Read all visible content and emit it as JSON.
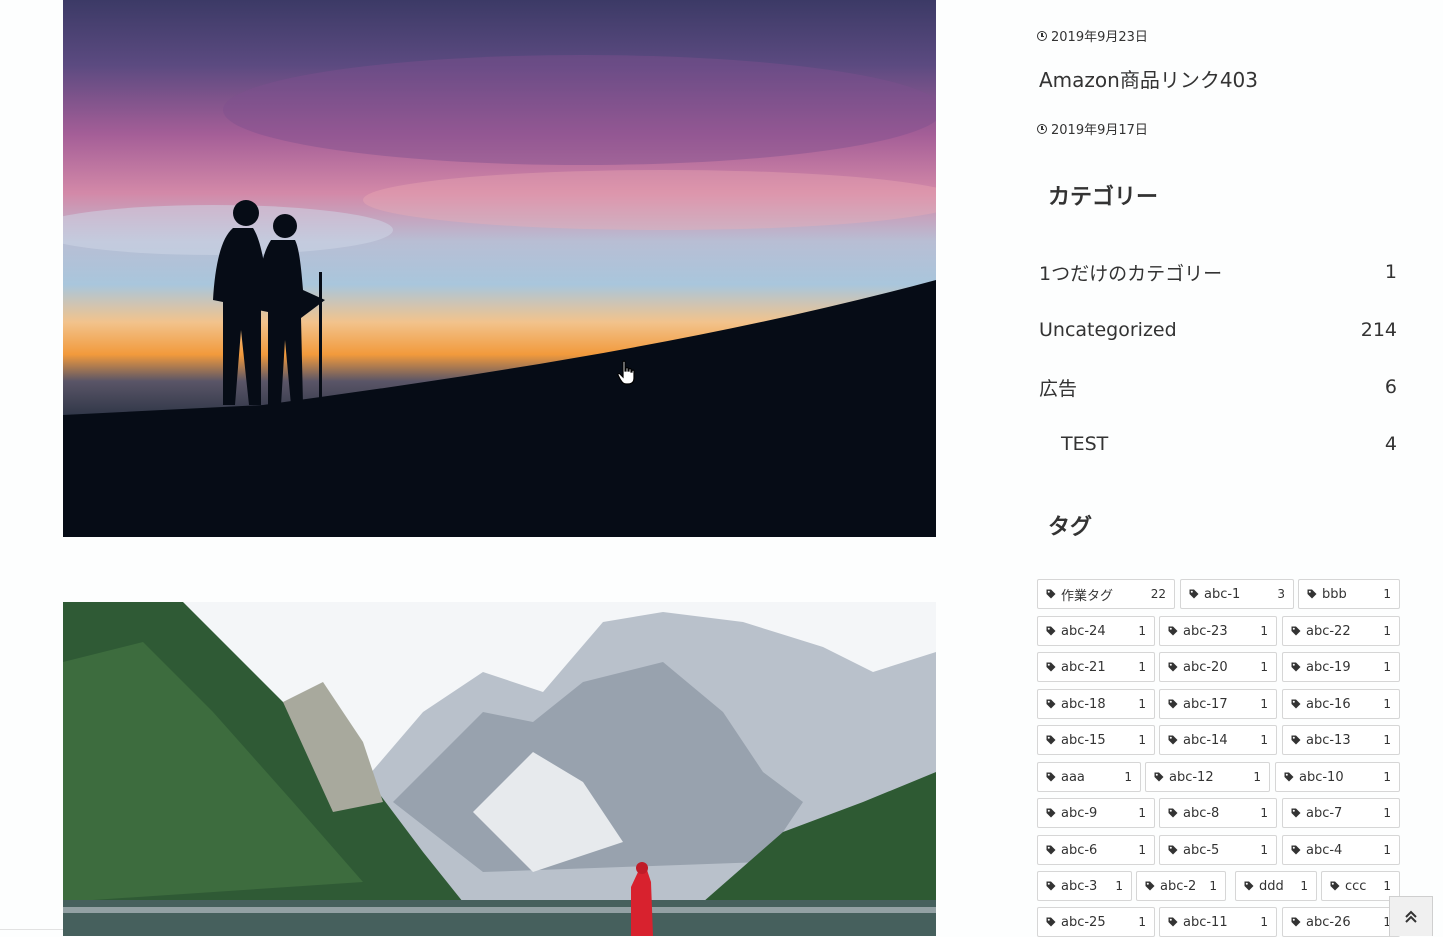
{
  "recent_posts": {
    "first_date": "2019年9月23日",
    "second_title": "Amazon商品リンク403",
    "second_date": "2019年9月17日"
  },
  "categories": {
    "title": "カテゴリー",
    "items": [
      {
        "label": "1つだけのカテゴリー",
        "count": "1"
      },
      {
        "label": "Uncategorized",
        "count": "214"
      },
      {
        "label": "広告",
        "count": "6"
      },
      {
        "label": "TEST",
        "count": "4"
      }
    ]
  },
  "tags": {
    "title": "タグ",
    "items": [
      {
        "label": "作業タグ",
        "count": "22"
      },
      {
        "label": "abc-1",
        "count": "3"
      },
      {
        "label": "bbb",
        "count": "1"
      },
      {
        "label": "abc-24",
        "count": "1"
      },
      {
        "label": "abc-23",
        "count": "1"
      },
      {
        "label": "abc-22",
        "count": "1"
      },
      {
        "label": "abc-21",
        "count": "1"
      },
      {
        "label": "abc-20",
        "count": "1"
      },
      {
        "label": "abc-19",
        "count": "1"
      },
      {
        "label": "abc-18",
        "count": "1"
      },
      {
        "label": "abc-17",
        "count": "1"
      },
      {
        "label": "abc-16",
        "count": "1"
      },
      {
        "label": "abc-15",
        "count": "1"
      },
      {
        "label": "abc-14",
        "count": "1"
      },
      {
        "label": "abc-13",
        "count": "1"
      },
      {
        "label": "aaa",
        "count": "1"
      },
      {
        "label": "abc-12",
        "count": "1"
      },
      {
        "label": "abc-10",
        "count": "1"
      },
      {
        "label": "abc-9",
        "count": "1"
      },
      {
        "label": "abc-8",
        "count": "1"
      },
      {
        "label": "abc-7",
        "count": "1"
      },
      {
        "label": "abc-6",
        "count": "1"
      },
      {
        "label": "abc-5",
        "count": "1"
      },
      {
        "label": "abc-4",
        "count": "1"
      },
      {
        "label": "abc-3",
        "count": "1"
      },
      {
        "label": "abc-2",
        "count": "1"
      },
      {
        "label": "ddd",
        "count": "1"
      },
      {
        "label": "ccc",
        "count": "1"
      },
      {
        "label": "abc-25",
        "count": "1"
      },
      {
        "label": "abc-11",
        "count": "1"
      },
      {
        "label": "abc-26",
        "count": "1"
      }
    ]
  },
  "icons": {
    "date": "clock-icon",
    "tag": "tag-icon",
    "scroll_top": "double-chevron-up-icon",
    "cursor": "hand-pointer-icon"
  },
  "colors": {
    "text": "#333333",
    "tag_border": "#d6d6d6",
    "background": "#fdfefe"
  }
}
